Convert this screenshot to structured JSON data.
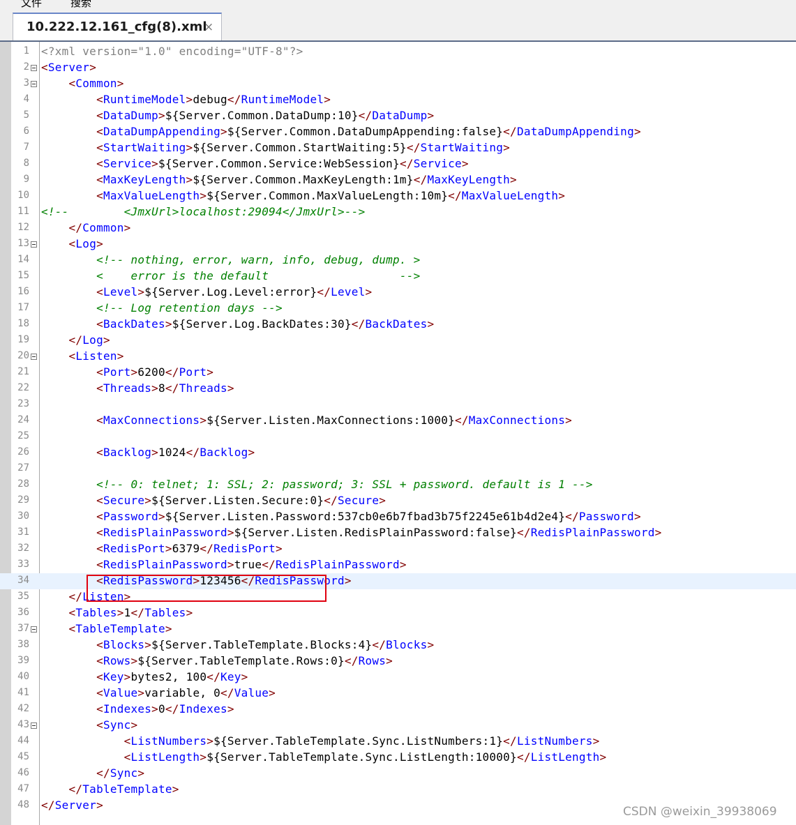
{
  "menubar": {
    "items": [
      "文件",
      "搜索"
    ]
  },
  "tab": {
    "title": "10.222.12.161_cfg(8).xml",
    "close_glyph": "×"
  },
  "editor": {
    "current_line": 34,
    "lines": [
      {
        "n": "1",
        "fold": false,
        "tokens": [
          {
            "c": "pi",
            "t": "<?xml version=\"1.0\" encoding=\"UTF-8\"?>"
          }
        ]
      },
      {
        "n": "2",
        "fold": true,
        "tokens": [
          {
            "c": "t",
            "t": "<Server>"
          }
        ]
      },
      {
        "n": "3",
        "fold": true,
        "tokens": [
          {
            "c": "p",
            "t": "    "
          },
          {
            "c": "t",
            "t": "<Common>"
          }
        ]
      },
      {
        "n": "4",
        "fold": false,
        "tokens": [
          {
            "c": "p",
            "t": "        "
          },
          {
            "c": "t",
            "t": "<RuntimeModel>"
          },
          {
            "c": "p",
            "t": "debug"
          },
          {
            "c": "t",
            "t": "</RuntimeModel>"
          }
        ]
      },
      {
        "n": "5",
        "fold": false,
        "tokens": [
          {
            "c": "p",
            "t": "        "
          },
          {
            "c": "t",
            "t": "<DataDump>"
          },
          {
            "c": "p",
            "t": "${Server.Common.DataDump:10}"
          },
          {
            "c": "t",
            "t": "</DataDump>"
          }
        ]
      },
      {
        "n": "6",
        "fold": false,
        "tokens": [
          {
            "c": "p",
            "t": "        "
          },
          {
            "c": "t",
            "t": "<DataDumpAppending>"
          },
          {
            "c": "p",
            "t": "${Server.Common.DataDumpAppending:false}"
          },
          {
            "c": "t",
            "t": "</DataDumpAppending>"
          }
        ]
      },
      {
        "n": "7",
        "fold": false,
        "tokens": [
          {
            "c": "p",
            "t": "        "
          },
          {
            "c": "t",
            "t": "<StartWaiting>"
          },
          {
            "c": "p",
            "t": "${Server.Common.StartWaiting:5}"
          },
          {
            "c": "t",
            "t": "</StartWaiting>"
          }
        ]
      },
      {
        "n": "8",
        "fold": false,
        "tokens": [
          {
            "c": "p",
            "t": "        "
          },
          {
            "c": "t",
            "t": "<Service>"
          },
          {
            "c": "p",
            "t": "${Server.Common.Service:WebSession}"
          },
          {
            "c": "t",
            "t": "</Service>"
          }
        ]
      },
      {
        "n": "9",
        "fold": false,
        "tokens": [
          {
            "c": "p",
            "t": "        "
          },
          {
            "c": "t",
            "t": "<MaxKeyLength>"
          },
          {
            "c": "p",
            "t": "${Server.Common.MaxKeyLength:1m}"
          },
          {
            "c": "t",
            "t": "</MaxKeyLength>"
          }
        ]
      },
      {
        "n": "10",
        "fold": false,
        "tokens": [
          {
            "c": "p",
            "t": "        "
          },
          {
            "c": "t",
            "t": "<MaxValueLength>"
          },
          {
            "c": "p",
            "t": "${Server.Common.MaxValueLength:10m}"
          },
          {
            "c": "t",
            "t": "</MaxValueLength>"
          }
        ]
      },
      {
        "n": "11",
        "fold": false,
        "tokens": [
          {
            "c": "c",
            "t": "<!--        <JmxUrl>localhost:29094</JmxUrl>-->"
          }
        ]
      },
      {
        "n": "12",
        "fold": false,
        "tokens": [
          {
            "c": "p",
            "t": "    "
          },
          {
            "c": "t",
            "t": "</Common>"
          }
        ]
      },
      {
        "n": "13",
        "fold": true,
        "tokens": [
          {
            "c": "p",
            "t": "    "
          },
          {
            "c": "t",
            "t": "<Log>"
          }
        ]
      },
      {
        "n": "14",
        "fold": false,
        "tokens": [
          {
            "c": "p",
            "t": "        "
          },
          {
            "c": "c",
            "t": "<!-- nothing, error, warn, info, debug, dump. >"
          }
        ]
      },
      {
        "n": "15",
        "fold": false,
        "tokens": [
          {
            "c": "p",
            "t": "        "
          },
          {
            "c": "c",
            "t": "<    error is the default                   -->"
          }
        ]
      },
      {
        "n": "16",
        "fold": false,
        "tokens": [
          {
            "c": "p",
            "t": "        "
          },
          {
            "c": "t",
            "t": "<Level>"
          },
          {
            "c": "p",
            "t": "${Server.Log.Level:error}"
          },
          {
            "c": "t",
            "t": "</Level>"
          }
        ]
      },
      {
        "n": "17",
        "fold": false,
        "tokens": [
          {
            "c": "p",
            "t": "        "
          },
          {
            "c": "c",
            "t": "<!-- Log retention days -->"
          }
        ]
      },
      {
        "n": "18",
        "fold": false,
        "tokens": [
          {
            "c": "p",
            "t": "        "
          },
          {
            "c": "t",
            "t": "<BackDates>"
          },
          {
            "c": "p",
            "t": "${Server.Log.BackDates:30}"
          },
          {
            "c": "t",
            "t": "</BackDates>"
          }
        ]
      },
      {
        "n": "19",
        "fold": false,
        "tokens": [
          {
            "c": "p",
            "t": "    "
          },
          {
            "c": "t",
            "t": "</Log>"
          }
        ]
      },
      {
        "n": "20",
        "fold": true,
        "tokens": [
          {
            "c": "p",
            "t": "    "
          },
          {
            "c": "t",
            "t": "<Listen>"
          }
        ]
      },
      {
        "n": "21",
        "fold": false,
        "tokens": [
          {
            "c": "p",
            "t": "        "
          },
          {
            "c": "t",
            "t": "<Port>"
          },
          {
            "c": "p",
            "t": "6200"
          },
          {
            "c": "t",
            "t": "</Port>"
          }
        ]
      },
      {
        "n": "22",
        "fold": false,
        "tokens": [
          {
            "c": "p",
            "t": "        "
          },
          {
            "c": "t",
            "t": "<Threads>"
          },
          {
            "c": "p",
            "t": "8"
          },
          {
            "c": "t",
            "t": "</Threads>"
          }
        ]
      },
      {
        "n": "23",
        "fold": false,
        "tokens": []
      },
      {
        "n": "24",
        "fold": false,
        "tokens": [
          {
            "c": "p",
            "t": "        "
          },
          {
            "c": "t",
            "t": "<MaxConnections>"
          },
          {
            "c": "p",
            "t": "${Server.Listen.MaxConnections:1000}"
          },
          {
            "c": "t",
            "t": "</MaxConnections>"
          }
        ]
      },
      {
        "n": "25",
        "fold": false,
        "tokens": []
      },
      {
        "n": "26",
        "fold": false,
        "tokens": [
          {
            "c": "p",
            "t": "        "
          },
          {
            "c": "t",
            "t": "<Backlog>"
          },
          {
            "c": "p",
            "t": "1024"
          },
          {
            "c": "t",
            "t": "</Backlog>"
          }
        ]
      },
      {
        "n": "27",
        "fold": false,
        "tokens": []
      },
      {
        "n": "28",
        "fold": false,
        "tokens": [
          {
            "c": "p",
            "t": "        "
          },
          {
            "c": "c",
            "t": "<!-- 0: telnet; 1: SSL; 2: password; 3: SSL + password. default is 1 -->"
          }
        ]
      },
      {
        "n": "29",
        "fold": false,
        "tokens": [
          {
            "c": "p",
            "t": "        "
          },
          {
            "c": "t",
            "t": "<Secure>"
          },
          {
            "c": "p",
            "t": "${Server.Listen.Secure:0}"
          },
          {
            "c": "t",
            "t": "</Secure>"
          }
        ]
      },
      {
        "n": "30",
        "fold": false,
        "tokens": [
          {
            "c": "p",
            "t": "        "
          },
          {
            "c": "t",
            "t": "<Password>"
          },
          {
            "c": "p",
            "t": "${Server.Listen.Password:537cb0e6b7fbad3b75f2245e61b4d2e4}"
          },
          {
            "c": "t",
            "t": "</Password>"
          }
        ]
      },
      {
        "n": "31",
        "fold": false,
        "tokens": [
          {
            "c": "p",
            "t": "        "
          },
          {
            "c": "t",
            "t": "<RedisPlainPassword>"
          },
          {
            "c": "p",
            "t": "${Server.Listen.RedisPlainPassword:false}"
          },
          {
            "c": "t",
            "t": "</RedisPlainPassword>"
          }
        ]
      },
      {
        "n": "32",
        "fold": false,
        "tokens": [
          {
            "c": "p",
            "t": "        "
          },
          {
            "c": "t",
            "t": "<RedisPort>"
          },
          {
            "c": "p",
            "t": "6379"
          },
          {
            "c": "t",
            "t": "</RedisPort>"
          }
        ]
      },
      {
        "n": "33",
        "fold": false,
        "tokens": [
          {
            "c": "p",
            "t": "        "
          },
          {
            "c": "t",
            "t": "<RedisPlainPassword>"
          },
          {
            "c": "p",
            "t": "true"
          },
          {
            "c": "t",
            "t": "</RedisPlainPassword>"
          }
        ]
      },
      {
        "n": "34",
        "fold": false,
        "tokens": [
          {
            "c": "p",
            "t": "        "
          },
          {
            "c": "t",
            "t": "<RedisPassword>"
          },
          {
            "c": "p",
            "t": "123456"
          },
          {
            "c": "t",
            "t": "</RedisPassword>"
          }
        ]
      },
      {
        "n": "35",
        "fold": false,
        "tokens": [
          {
            "c": "p",
            "t": "    "
          },
          {
            "c": "t",
            "t": "</Listen>"
          }
        ]
      },
      {
        "n": "36",
        "fold": false,
        "tokens": [
          {
            "c": "p",
            "t": "    "
          },
          {
            "c": "t",
            "t": "<Tables>"
          },
          {
            "c": "p",
            "t": "1"
          },
          {
            "c": "t",
            "t": "</Tables>"
          }
        ]
      },
      {
        "n": "37",
        "fold": true,
        "tokens": [
          {
            "c": "p",
            "t": "    "
          },
          {
            "c": "t",
            "t": "<TableTemplate>"
          }
        ]
      },
      {
        "n": "38",
        "fold": false,
        "tokens": [
          {
            "c": "p",
            "t": "        "
          },
          {
            "c": "t",
            "t": "<Blocks>"
          },
          {
            "c": "p",
            "t": "${Server.TableTemplate.Blocks:4}"
          },
          {
            "c": "t",
            "t": "</Blocks>"
          }
        ]
      },
      {
        "n": "39",
        "fold": false,
        "tokens": [
          {
            "c": "p",
            "t": "        "
          },
          {
            "c": "t",
            "t": "<Rows>"
          },
          {
            "c": "p",
            "t": "${Server.TableTemplate.Rows:0}"
          },
          {
            "c": "t",
            "t": "</Rows>"
          }
        ]
      },
      {
        "n": "40",
        "fold": false,
        "tokens": [
          {
            "c": "p",
            "t": "        "
          },
          {
            "c": "t",
            "t": "<Key>"
          },
          {
            "c": "p",
            "t": "bytes2, 100"
          },
          {
            "c": "t",
            "t": "</Key>"
          }
        ]
      },
      {
        "n": "41",
        "fold": false,
        "tokens": [
          {
            "c": "p",
            "t": "        "
          },
          {
            "c": "t",
            "t": "<Value>"
          },
          {
            "c": "p",
            "t": "variable, 0"
          },
          {
            "c": "t",
            "t": "</Value>"
          }
        ]
      },
      {
        "n": "42",
        "fold": false,
        "tokens": [
          {
            "c": "p",
            "t": "        "
          },
          {
            "c": "t",
            "t": "<Indexes>"
          },
          {
            "c": "p",
            "t": "0"
          },
          {
            "c": "t",
            "t": "</Indexes>"
          }
        ]
      },
      {
        "n": "43",
        "fold": true,
        "tokens": [
          {
            "c": "p",
            "t": "        "
          },
          {
            "c": "t",
            "t": "<Sync>"
          }
        ]
      },
      {
        "n": "44",
        "fold": false,
        "tokens": [
          {
            "c": "p",
            "t": "            "
          },
          {
            "c": "t",
            "t": "<ListNumbers>"
          },
          {
            "c": "p",
            "t": "${Server.TableTemplate.Sync.ListNumbers:1}"
          },
          {
            "c": "t",
            "t": "</ListNumbers>"
          }
        ]
      },
      {
        "n": "45",
        "fold": false,
        "tokens": [
          {
            "c": "p",
            "t": "            "
          },
          {
            "c": "t",
            "t": "<ListLength>"
          },
          {
            "c": "p",
            "t": "${Server.TableTemplate.Sync.ListLength:10000}"
          },
          {
            "c": "t",
            "t": "</ListLength>"
          }
        ]
      },
      {
        "n": "46",
        "fold": false,
        "tokens": [
          {
            "c": "p",
            "t": "        "
          },
          {
            "c": "t",
            "t": "</Sync>"
          }
        ]
      },
      {
        "n": "47",
        "fold": false,
        "tokens": [
          {
            "c": "p",
            "t": "    "
          },
          {
            "c": "t",
            "t": "</TableTemplate>"
          }
        ]
      },
      {
        "n": "48",
        "fold": false,
        "tokens": [
          {
            "c": "t",
            "t": "</Server>"
          }
        ]
      }
    ]
  },
  "annotation": {
    "color": "#e0000f",
    "target_line": 32
  },
  "watermark": "CSDN @weixin_39938069",
  "colors": {
    "tag": "#0000ff",
    "bracket": "#800000",
    "comment": "#008000",
    "prolog": "#808080",
    "text": "#000000",
    "current_line": "#e8f2fe"
  }
}
